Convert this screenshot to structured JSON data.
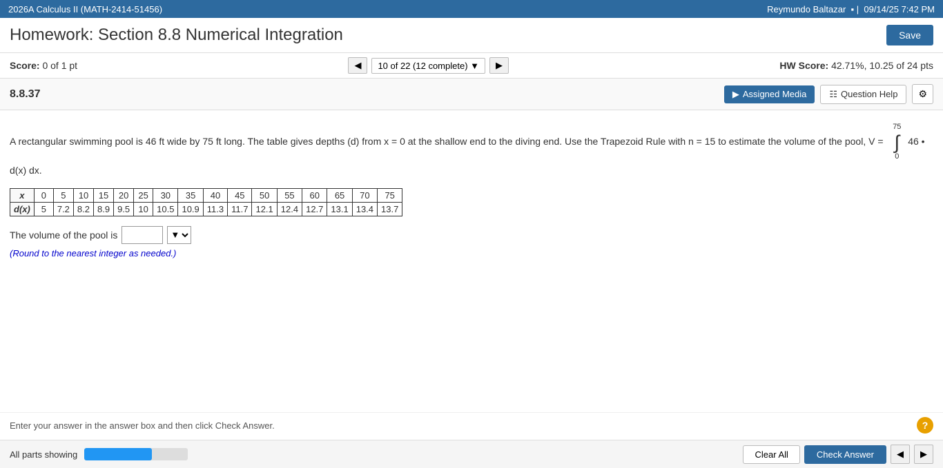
{
  "topbar": {
    "course": "2026A Calculus II (MATH-2414-51456)",
    "user": "Reymundo Baltazar",
    "datetime": "09/14/25 7:42 PM",
    "separator": "|"
  },
  "header": {
    "title": "Homework: Section 8.8 Numerical Integration",
    "save_label": "Save"
  },
  "score_bar": {
    "score_label": "Score:",
    "score_value": "0 of 1 pt",
    "nav_text": "10 of 22 (12 complete)",
    "hw_score_label": "HW Score:",
    "hw_score_value": "42.71%, 10.25 of 24 pts"
  },
  "question_bar": {
    "question_number": "8.8.37",
    "assigned_media_label": "Assigned Media",
    "question_help_label": "Question Help",
    "gear_icon": "⚙"
  },
  "problem": {
    "text": "A rectangular swimming pool is 46 ft wide by 75 ft long. The table gives depths (d) from x = 0 at the shallow end to the diving end. Use the Trapezoid Rule with n = 15 to estimate the volume of the pool, V =",
    "integral_top": "75",
    "integral_bottom": "0",
    "integral_expr": "46 • d(x) dx.",
    "table": {
      "x_label": "x",
      "d_label": "d(x)",
      "x_values": [
        "0",
        "5",
        "10",
        "15",
        "20",
        "25",
        "30",
        "35",
        "40",
        "45",
        "50",
        "55",
        "60",
        "65",
        "70",
        "75"
      ],
      "d_values": [
        "5",
        "7.2",
        "8.2",
        "8.9",
        "9.5",
        "10",
        "10.5",
        "10.9",
        "11.3",
        "11.7",
        "12.1",
        "12.4",
        "12.7",
        "13.1",
        "13.4",
        "13.7"
      ]
    },
    "answer_prefix": "The volume of the pool is",
    "round_note": "(Round to the nearest integer as needed.)"
  },
  "bottom": {
    "instruction": "Enter your answer in the answer box and then click Check Answer.",
    "all_parts_label": "All parts showing",
    "progress_pct": 65,
    "clear_all_label": "Clear All",
    "check_answer_label": "Check Answer"
  }
}
